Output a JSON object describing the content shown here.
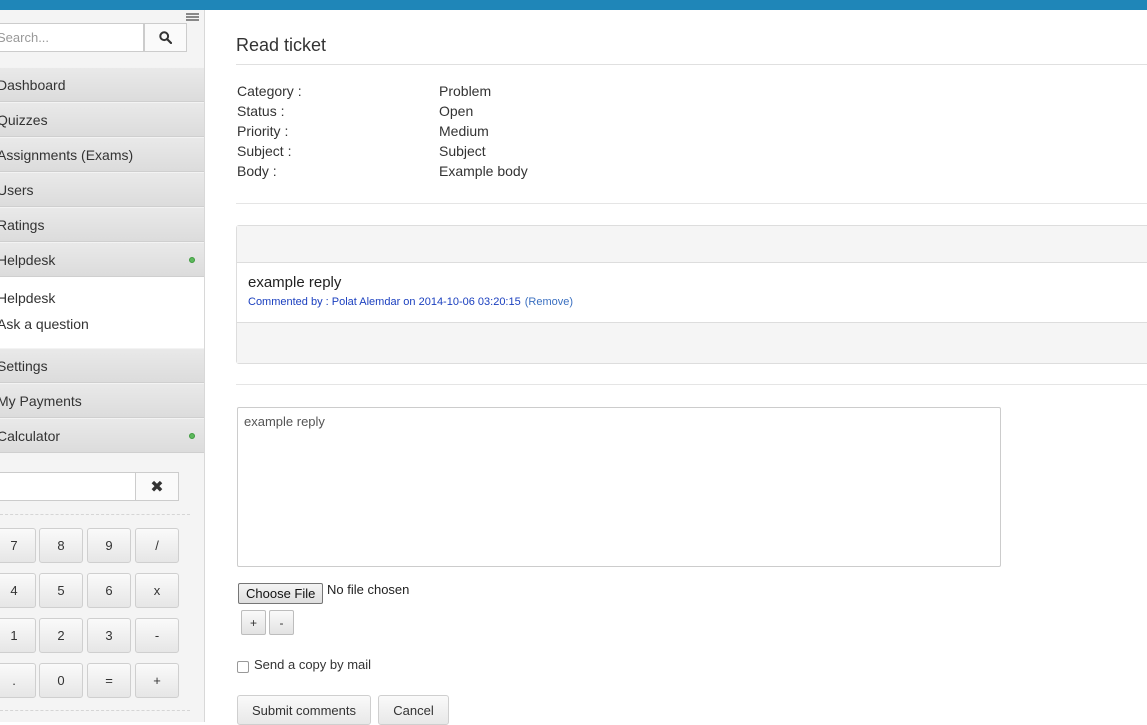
{
  "sidebar": {
    "search_placeholder": "Search...",
    "nav": [
      {
        "label": "Dashboard"
      },
      {
        "label": "Quizzes"
      },
      {
        "label": "Assignments (Exams)"
      },
      {
        "label": "Users"
      },
      {
        "label": "Ratings"
      },
      {
        "label": "Helpdesk",
        "active_dot": true
      }
    ],
    "helpdesk_sub": [
      {
        "label": "Helpdesk"
      },
      {
        "label": "Ask a question"
      }
    ],
    "nav_bottom": [
      {
        "label": "Settings"
      },
      {
        "label": "My Payments"
      },
      {
        "label": "Calculator",
        "active_dot": true
      }
    ],
    "calculator": {
      "display": "",
      "clear_icon": "close-icon",
      "keys": [
        [
          "7",
          "8",
          "9",
          "/"
        ],
        [
          "4",
          "5",
          "6",
          "x"
        ],
        [
          "1",
          "2",
          "3",
          "-"
        ],
        [
          ".",
          "0",
          "=",
          "+"
        ]
      ]
    }
  },
  "ticket": {
    "title": "Read ticket",
    "fields": [
      {
        "key": "Category :",
        "value": "Problem"
      },
      {
        "key": "Status :",
        "value": "Open"
      },
      {
        "key": "Priority :",
        "value": "Medium"
      },
      {
        "key": "Subject :",
        "value": "Subject"
      },
      {
        "key": "Body :",
        "value": "Example body"
      }
    ]
  },
  "comments": [
    {
      "text": "example reply",
      "meta": "Commented by : Polat Alemdar on 2014-10-06 03:20:15",
      "remove_label": "(Remove)"
    }
  ],
  "reply_form": {
    "textarea_value": "example reply",
    "choose_file_label": "Choose File",
    "no_file_text": "No file chosen",
    "add_label": "+",
    "remove_label": "-",
    "send_copy_label": "Send a copy by mail",
    "submit_label": "Submit comments",
    "cancel_label": "Cancel"
  },
  "colors": {
    "topbar": "#1f86b8",
    "status_dot": "#5cb85c",
    "link_blue": "#1a3fbf"
  }
}
